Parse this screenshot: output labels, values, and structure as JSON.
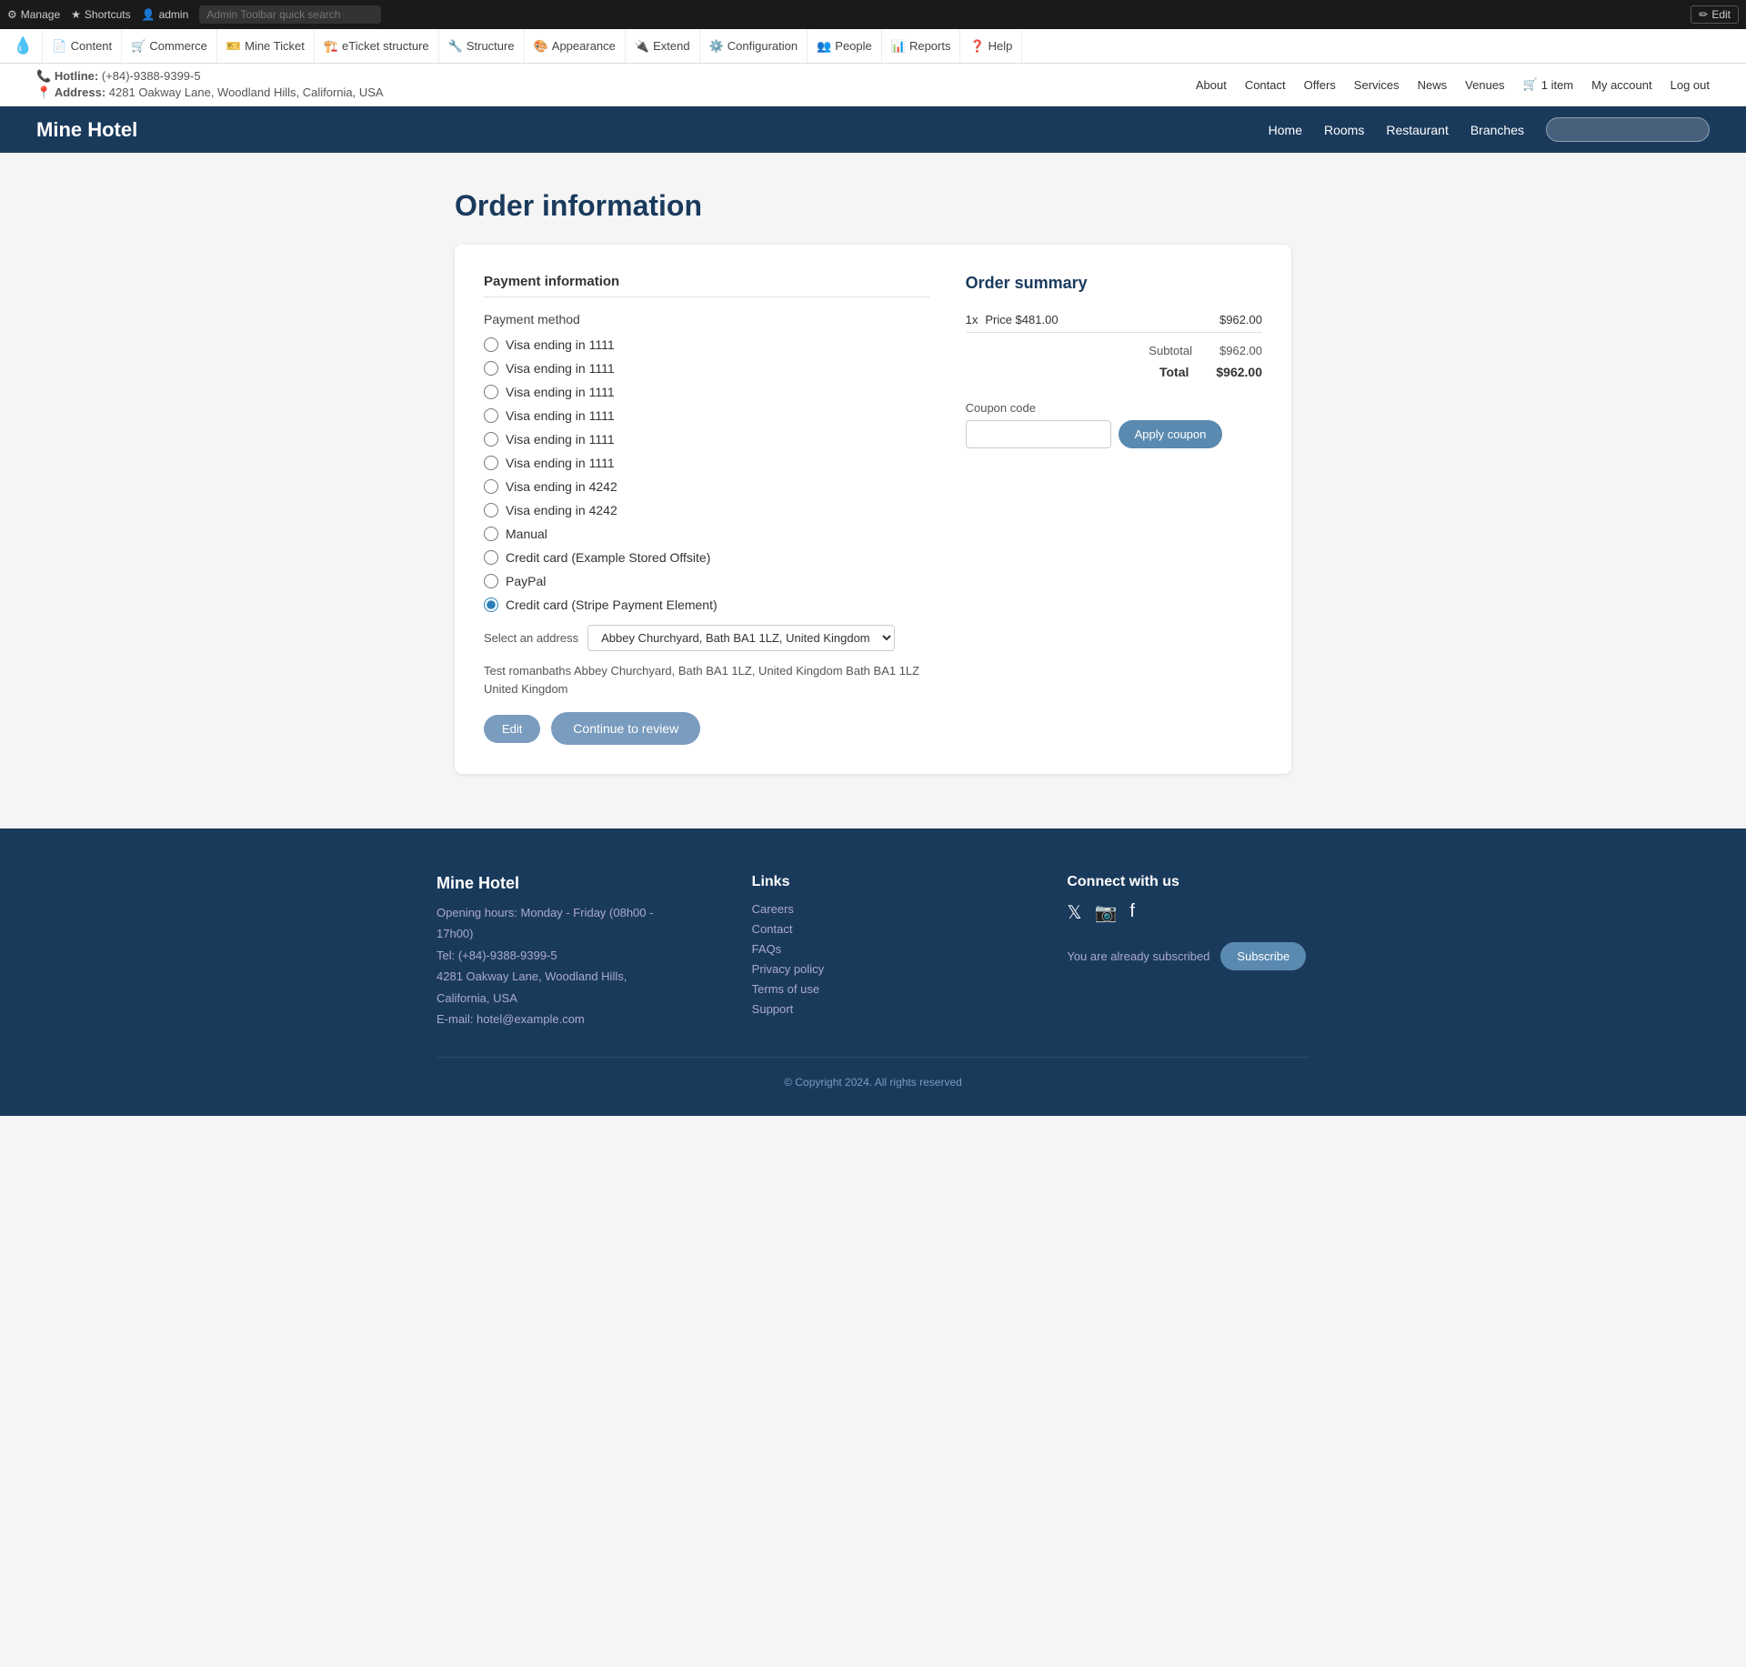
{
  "admin_bar": {
    "manage_label": "Manage",
    "shortcuts_label": "Shortcuts",
    "user_label": "admin",
    "search_placeholder": "Admin Toolbar quick search",
    "edit_label": "Edit"
  },
  "drupal_toolbar": {
    "items": [
      {
        "label": "Content",
        "icon": "📄"
      },
      {
        "label": "Commerce",
        "icon": "🛒"
      },
      {
        "label": "Mine Ticket",
        "icon": "🎫"
      },
      {
        "label": "eTicket structure",
        "icon": "🏗️"
      },
      {
        "label": "Structure",
        "icon": "🔧"
      },
      {
        "label": "Appearance",
        "icon": "🎨"
      },
      {
        "label": "Extend",
        "icon": "🔌"
      },
      {
        "label": "Configuration",
        "icon": "⚙️"
      },
      {
        "label": "People",
        "icon": "👤"
      },
      {
        "label": "Reports",
        "icon": "📊"
      },
      {
        "label": "Help",
        "icon": "❓"
      }
    ]
  },
  "topbar": {
    "hotline_label": "Hotline:",
    "hotline_number": "(+84)-9388-9399-5",
    "address_label": "Address:",
    "address_text": "4281 Oakway Lane, Woodland Hills, California, USA",
    "nav_links": [
      "About",
      "Contact",
      "Offers",
      "Services",
      "News",
      "Venues"
    ],
    "cart_label": "1 item",
    "account_label": "My account",
    "logout_label": "Log out"
  },
  "site_header": {
    "logo": "Mine Hotel",
    "nav": [
      "Home",
      "Rooms",
      "Restaurant",
      "Branches"
    ],
    "search_placeholder": ""
  },
  "page": {
    "title": "Order information",
    "payment_section_heading": "Payment information",
    "payment_method_label": "Payment method",
    "payment_options": [
      {
        "label": "Visa ending in 1111",
        "selected": false
      },
      {
        "label": "Visa ending in 1111",
        "selected": false
      },
      {
        "label": "Visa ending in 1111",
        "selected": false
      },
      {
        "label": "Visa ending in 1111",
        "selected": false
      },
      {
        "label": "Visa ending in 1111",
        "selected": false
      },
      {
        "label": "Visa ending in 1111",
        "selected": false
      },
      {
        "label": "Visa ending in 4242",
        "selected": false
      },
      {
        "label": "Visa ending in 4242",
        "selected": false
      },
      {
        "label": "Manual",
        "selected": false
      },
      {
        "label": "Credit card (Example Stored Offsite)",
        "selected": false
      },
      {
        "label": "PayPal",
        "selected": false
      },
      {
        "label": "Credit card (Stripe Payment Element)",
        "selected": true
      }
    ],
    "address_label": "Select an address",
    "address_value": "Abbey Churchyard, Bath BA1 1LZ, United Kingdom",
    "address_text": "Test romanbaths Abbey Churchyard, Bath BA1 1LZ, United Kingdom Bath BA1 1LZ United Kingdom",
    "edit_button": "Edit",
    "continue_button": "Continue to review",
    "order_summary_title": "Order summary",
    "order_line_qty": "1x",
    "order_line_label": "Price $481.00",
    "order_line_amount": "$962.00",
    "subtotal_label": "Subtotal",
    "subtotal_amount": "$962.00",
    "total_label": "Total",
    "total_amount": "$962.00",
    "coupon_label": "Coupon code",
    "coupon_placeholder": "",
    "apply_coupon_button": "Apply coupon"
  },
  "footer": {
    "brand": "Mine Hotel",
    "opening_hours": "Opening hours: Monday - Friday (08h00 - 17h00)",
    "tel": "Tel: (+84)-9388-9399-5",
    "address": "4281 Oakway Lane, Woodland Hills, California, USA",
    "email": "E-mail: hotel@example.com",
    "links_heading": "Links",
    "links": [
      "Careers",
      "Contact",
      "FAQs",
      "Privacy policy",
      "Terms of use",
      "Support"
    ],
    "connect_heading": "Connect with us",
    "subscribe_text": "You are already subscribed",
    "subscribe_button": "Subscribe",
    "copyright": "© Copyright 2024. All rights reserved"
  }
}
